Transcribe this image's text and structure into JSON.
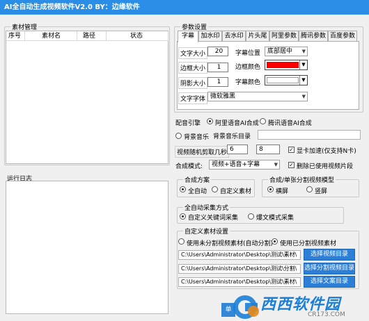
{
  "window": {
    "title": "AI全自动生成视频软件V2.0 BY：边缘软件"
  },
  "material": {
    "group_title": "素材管理",
    "columns": [
      "序号",
      "素材名",
      "路径",
      "状态"
    ]
  },
  "log": {
    "label": "运行日志"
  },
  "params": {
    "group_title": "参数设置",
    "tabs": [
      "字幕",
      "加水印",
      "去水印",
      "片头尾",
      "阿里参数",
      "腾讯参数",
      "百度参数"
    ],
    "font_size_label": "文字大小",
    "font_size_value": "20",
    "subtitle_pos_label": "字幕位置",
    "subtitle_pos_value": "底部居中",
    "border_size_label": "边框大小",
    "border_size_value": "1",
    "border_color_label": "边框颜色",
    "border_color": "#ff0000",
    "shadow_size_label": "阴影大小",
    "shadow_size_value": "1",
    "subtitle_color_label": "字幕颜色",
    "subtitle_color": "#ffffff",
    "font_family_label": "文字字体",
    "font_family_value": "微软雅黑"
  },
  "dub": {
    "label": "配音引擎",
    "options": [
      "阿里语音AI合成",
      "腾讯语音AI合成"
    ]
  },
  "bgm": {
    "checkbox_label": "背景音乐",
    "dir_label": "背景音乐目录",
    "dir_value": ""
  },
  "cut": {
    "label": "视频随机剪取几秒",
    "value1": "6",
    "value2": "8",
    "gpu_label": "显卡加速(仅支持N卡)"
  },
  "compose": {
    "mode_label": "合成模式:",
    "mode_value": "视频+语音+字幕",
    "delete_used_label": "删除已使用视频片段"
  },
  "scheme": {
    "group_title": "合成方案",
    "options": [
      "全自动",
      "自定义素材"
    ]
  },
  "split": {
    "group_title": "合成/单张分割视频模型",
    "options": [
      "横屏",
      "竖屏"
    ]
  },
  "auto_collect": {
    "group_title": "全自动采集方式",
    "options": [
      "自定义关键词采集",
      "爆文模式采集"
    ]
  },
  "custom": {
    "group_title": "自定义素材设置",
    "options": [
      "使用未分割视频素材(自动分割)",
      "使用已分割视频素材"
    ],
    "paths": [
      "C:\\Users\\Administrator\\Desktop\\测试\\素材\\",
      "C:\\Users\\Administrator\\Desktop\\测试\\分割\\",
      "C:\\Users\\Administrator\\Desktop\\测试\\素材\\"
    ],
    "buttons": [
      "选择视频目录",
      "选择分割视频目录",
      "选择文案目录"
    ]
  },
  "bottom": {
    "partial_button": "单"
  },
  "watermark": {
    "brand": "西西软件园",
    "url": "CR173.COM"
  },
  "colors": {
    "titlebar": "#2b8ee6",
    "button": "#2b7fd6"
  }
}
